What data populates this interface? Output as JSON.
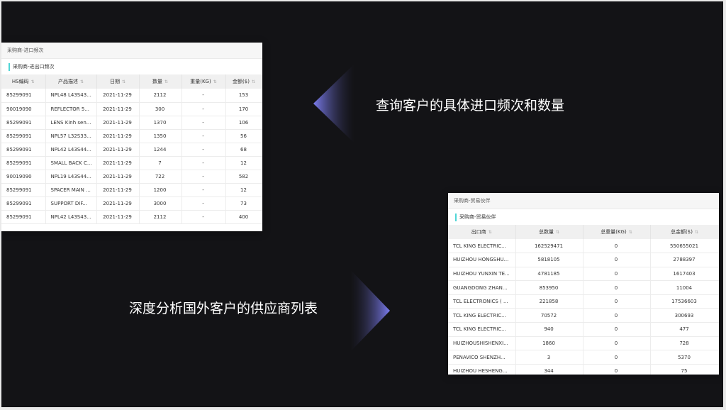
{
  "colors": {
    "accent": "#4fd5d6",
    "arrow": "#6d6ee0",
    "background": "#131316"
  },
  "panel1": {
    "title": "采购商-进口频次",
    "subtitle": "采购商-进出口频次",
    "columns": [
      "HS编码",
      "产品描述",
      "日期",
      "数量",
      "重量(KG)",
      "金额($)"
    ],
    "rows": [
      [
        "85299091",
        "NPL48 L43S43...",
        "2021-11-29",
        "2112",
        "-",
        "153"
      ],
      [
        "90019090",
        "REFLECTOR 5...",
        "2021-11-29",
        "300",
        "-",
        "170"
      ],
      [
        "85299091",
        "LENS Kinh sen...",
        "2021-11-29",
        "1370",
        "-",
        "106"
      ],
      [
        "85299091",
        "NPL57 L32S33...",
        "2021-11-29",
        "1350",
        "-",
        "56"
      ],
      [
        "85299091",
        "NPL42 L43S44...",
        "2021-11-29",
        "1244",
        "-",
        "68"
      ],
      [
        "85299091",
        "SMALL BACK C...",
        "2021-11-29",
        "7",
        "-",
        "12"
      ],
      [
        "90019090",
        "NPL19 L43S44...",
        "2021-11-29",
        "722",
        "-",
        "582"
      ],
      [
        "85299091",
        "SPACER MAIN ...",
        "2021-11-29",
        "1200",
        "-",
        "12"
      ],
      [
        "85299091",
        "SUPPORT DIF...",
        "2021-11-29",
        "3000",
        "-",
        "73"
      ],
      [
        "85299091",
        "NPL42 L43S43...",
        "2021-11-29",
        "2112",
        "-",
        "400"
      ]
    ]
  },
  "panel2": {
    "title": "采购商-贸易伙伴",
    "subtitle": "采购商-贸易伙伴",
    "columns": [
      "出口商",
      "总数量",
      "总重量(KG)",
      "总金额($)"
    ],
    "rows": [
      [
        "TCL KING ELECTRIC...",
        "162529471",
        "0",
        "550655021"
      ],
      [
        "HUIZHOU HONGSHU...",
        "5818105",
        "0",
        "2788397"
      ],
      [
        "HUIZHOU YUNXIN TE...",
        "4781185",
        "0",
        "1617403"
      ],
      [
        "GUANGDONG ZHAN...",
        "853950",
        "0",
        "11004"
      ],
      [
        "TCL ELECTRONICS ( ...",
        "221858",
        "0",
        "17536603"
      ],
      [
        "TCL KING ELECTRIC...",
        "70572",
        "0",
        "300693"
      ],
      [
        "TCL KING ELECTRIC...",
        "940",
        "0",
        "477"
      ],
      [
        "HUIZHOUSHISHENXI...",
        "1860",
        "0",
        "728"
      ],
      [
        "PENAVICO SHENZH...",
        "3",
        "0",
        "5370"
      ],
      [
        "HUIZHOU HESHENG...",
        "344",
        "0",
        "75"
      ]
    ]
  },
  "captions": {
    "top": "查询客户的具体进口频次和数量",
    "bottom": "深度分析国外客户的供应商列表"
  }
}
